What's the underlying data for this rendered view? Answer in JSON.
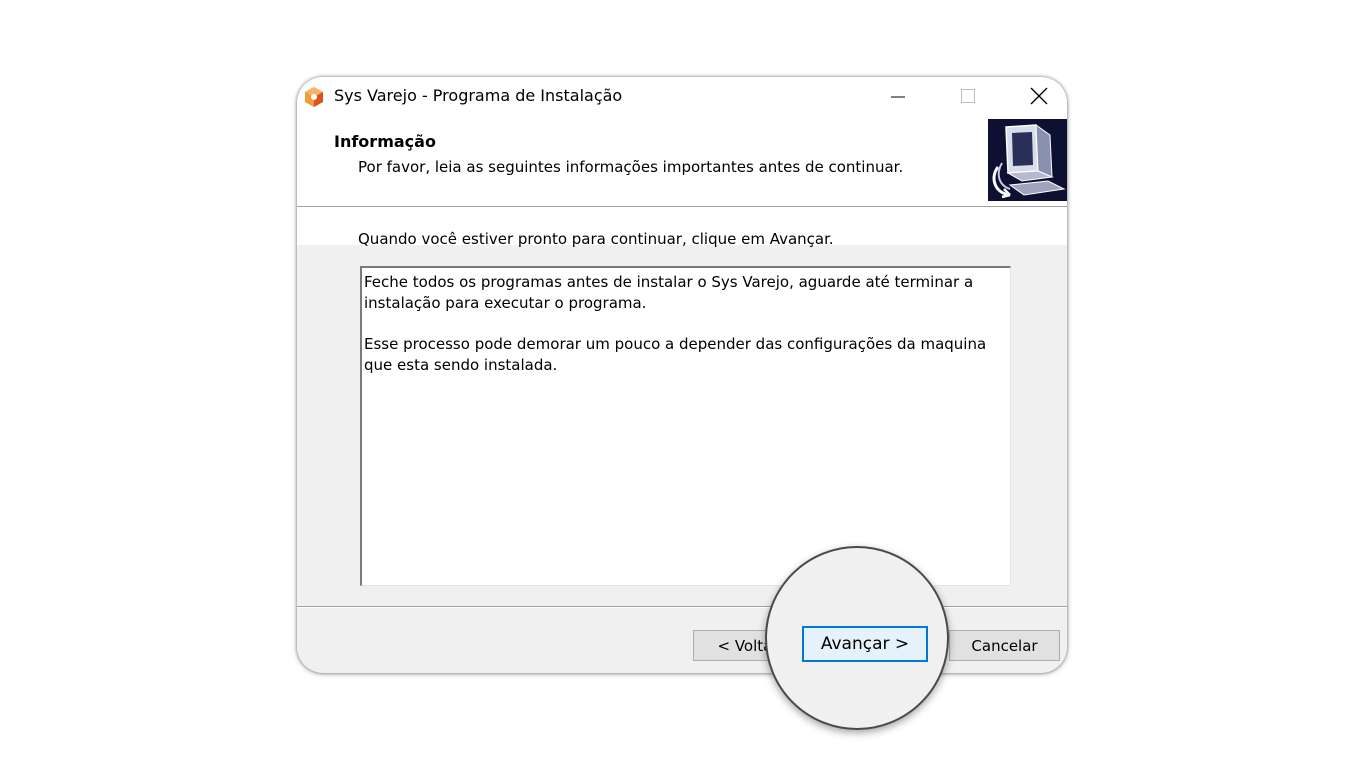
{
  "window": {
    "title": "Sys Varejo - Programa de Instalação"
  },
  "header": {
    "title": "Informação",
    "subtitle": "Por favor, leia as seguintes informações importantes antes de continuar."
  },
  "body": {
    "instruction": "Quando você estiver pronto para continuar, clique em Avançar.",
    "memo_lines": [
      "Feche todos os programas antes de instalar o Sys Varejo, aguarde até terminar a",
      "instalação para executar o programa.",
      "",
      "Esse processo pode demorar um pouco a depender das configurações da maquina",
      "que esta sendo instalada."
    ]
  },
  "buttons": {
    "back": "< Voltar",
    "next": "Avançar >",
    "cancel": "Cancelar"
  },
  "colors": {
    "accent": "#0078d7",
    "header_image_bg": "#0d1030",
    "app_icon": "#e8672a"
  }
}
